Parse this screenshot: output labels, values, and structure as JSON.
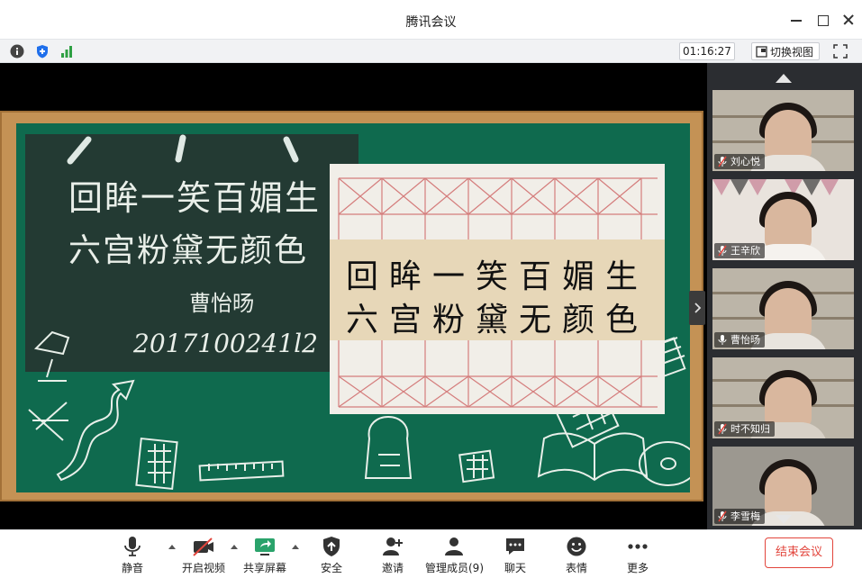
{
  "window": {
    "title": "腾讯会议"
  },
  "infobar": {
    "timer": "01:16:27",
    "switch_view_label": "切换视图"
  },
  "board": {
    "chalk_line1": "回眸一笑百媚生",
    "chalk_line2": "六宫粉黛无颜色",
    "chalk_signature": "曹怡旸",
    "chalk_date": "2017100241l2",
    "paper_line1": "回眸一笑百媚生",
    "paper_line2": "六宫粉黛无颜色"
  },
  "participants": [
    {
      "name": "刘心悦"
    },
    {
      "name": "王辛欣"
    },
    {
      "name": "曹怡旸"
    },
    {
      "name": "时不知归"
    },
    {
      "name": "李雪梅"
    }
  ],
  "toolbar": {
    "mute": "静音",
    "video": "开启视频",
    "share": "共享屏幕",
    "security": "安全",
    "invite": "邀请",
    "members": "管理成员(9)",
    "chat": "聊天",
    "reactions": "表情",
    "more": "更多",
    "end_meeting": "结束会议"
  },
  "colors": {
    "accent_red": "#e2453c",
    "board_green": "#0f6a4e",
    "frame_wood": "#c49255",
    "sidebar_bg": "#2b2d31"
  }
}
